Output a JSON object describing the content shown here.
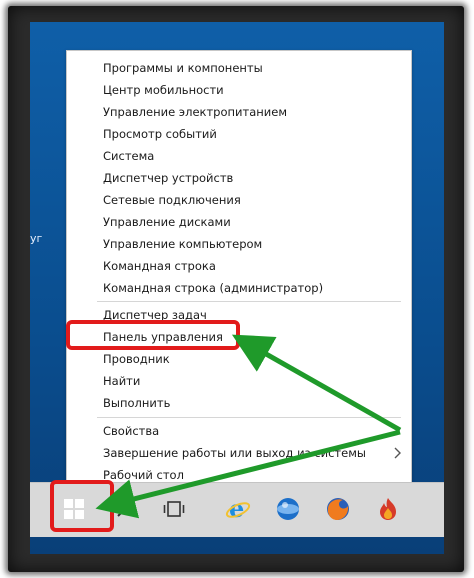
{
  "desktop": {
    "label": "уг"
  },
  "menu": {
    "items": [
      {
        "label": "Программы и компоненты"
      },
      {
        "label": "Центр мобильности"
      },
      {
        "label": "Управление электропитанием"
      },
      {
        "label": "Просмотр событий"
      },
      {
        "label": "Система"
      },
      {
        "label": "Диспетчер устройств"
      },
      {
        "label": "Сетевые подключения"
      },
      {
        "label": "Управление дисками"
      },
      {
        "label": "Управление компьютером"
      },
      {
        "label": "Командная строка"
      },
      {
        "label": "Командная строка (администратор)"
      },
      {
        "label": "Диспетчер задач"
      },
      {
        "label": "Панель управления"
      },
      {
        "label": "Проводник"
      },
      {
        "label": "Найти"
      },
      {
        "label": "Выполнить"
      },
      {
        "label": "Свойства"
      },
      {
        "label": "Завершение работы или выход из системы"
      },
      {
        "label": "Рабочий стол"
      }
    ]
  },
  "taskbar": {
    "buttons": [
      {
        "icon": "windows-start-icon"
      },
      {
        "icon": "search-icon"
      },
      {
        "icon": "task-view-icon"
      },
      {
        "icon": "internet-explorer-icon"
      },
      {
        "icon": "globe-browser-icon"
      },
      {
        "icon": "firefox-icon"
      },
      {
        "icon": "flame-app-icon"
      }
    ]
  },
  "colors": {
    "highlight": "#e21b1b",
    "arrow": "#1f9a2a",
    "desktop": "#0f5fa8",
    "taskbar": "#d9d9d9"
  }
}
